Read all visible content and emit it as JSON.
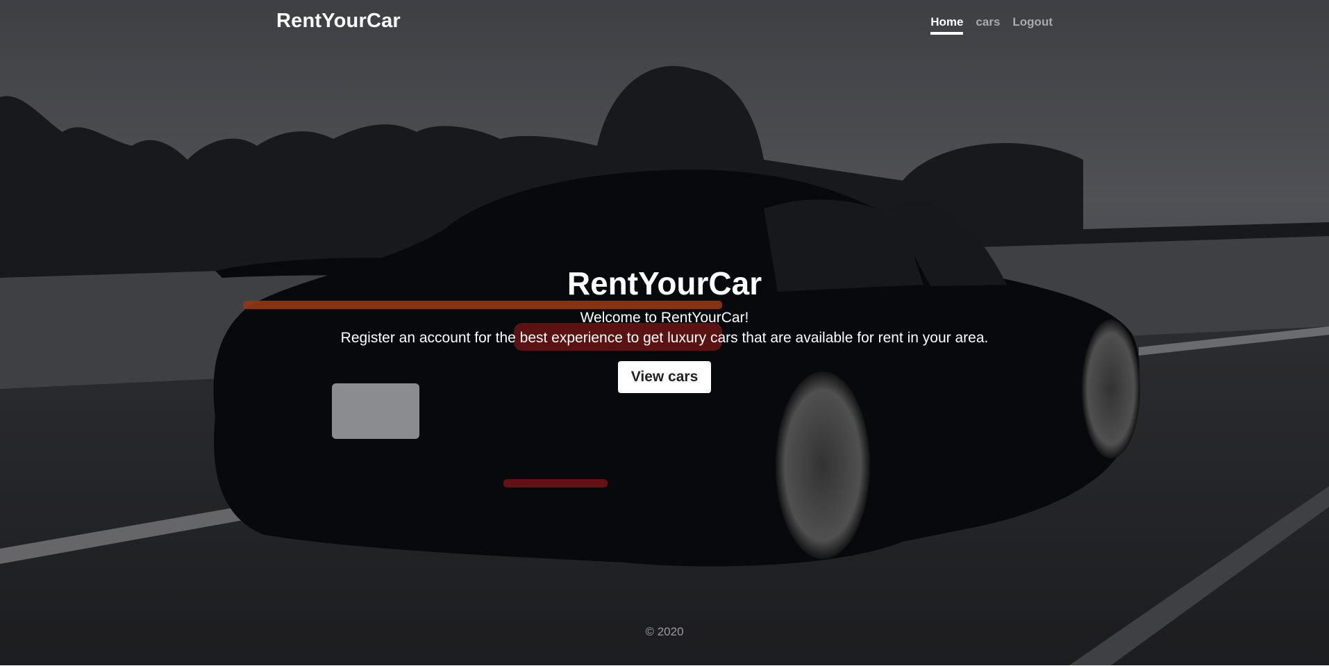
{
  "brand": "RentYourCar",
  "nav": {
    "home": "Home",
    "cars": "cars",
    "logout": "Logout"
  },
  "cover": {
    "heading": "RentYourCar",
    "lead_line1": "Welcome to RentYourCar!",
    "lead_line2": "Register an account for the best experience to get luxury cars that are available for rent in your area.",
    "button": "View cars"
  },
  "footer": {
    "copyright": "© 2020"
  },
  "colors": {
    "text": "#ffffff",
    "muted_nav": "#a8aab0",
    "button_bg": "#ffffff",
    "overlay": "#000000"
  }
}
